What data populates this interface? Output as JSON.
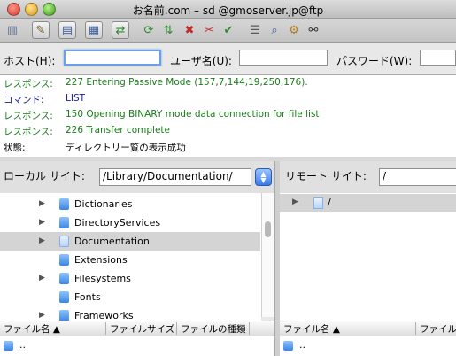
{
  "window": {
    "title": "お名前.com – sd                @gmoserver.jp@ftp"
  },
  "toolbar": {
    "icons": [
      "site-manager-icon",
      "toggle-log-icon",
      "toggle-local-tree-icon",
      "toggle-remote-tree-icon",
      "toggle-queue-icon",
      "refresh-icon",
      "process-queue-icon",
      "cancel-icon",
      "disconnect-icon",
      "reconnect-icon",
      "filter-icon",
      "compare-icon",
      "sync-browse-icon",
      "search-icon"
    ]
  },
  "quickconnect": {
    "host_label": "ホスト(H):",
    "host_value": "",
    "user_label": "ユーザ名(U):",
    "user_value": "",
    "pass_label": "パスワード(W):",
    "pass_value": ""
  },
  "log": [
    {
      "label": "レスポンス:",
      "message": "227 Entering Passive Mode (157,7,144,19,250,176).",
      "color": "#1a7a1a"
    },
    {
      "label": "コマンド:",
      "message": "LIST",
      "color": "#1a1a9a"
    },
    {
      "label": "レスポンス:",
      "message": "150 Opening BINARY mode data connection for file list",
      "color": "#1a7a1a"
    },
    {
      "label": "レスポンス:",
      "message": "226 Transfer complete",
      "color": "#1a7a1a"
    },
    {
      "label": "状態:",
      "message": "ディレクトリー覧の表示成功",
      "color": "#000000"
    }
  ],
  "local": {
    "label": "ローカル サイト:",
    "path": "/Library/Documentation/",
    "tree": [
      {
        "name": "Dictionaries",
        "expandable": true,
        "selected": false,
        "icon": "folder"
      },
      {
        "name": "DirectoryServices",
        "expandable": true,
        "selected": false,
        "icon": "folder"
      },
      {
        "name": "Documentation",
        "expandable": true,
        "selected": true,
        "icon": "document-folder"
      },
      {
        "name": "Extensions",
        "expandable": false,
        "selected": false,
        "icon": "folder"
      },
      {
        "name": "Filesystems",
        "expandable": true,
        "selected": false,
        "icon": "folder"
      },
      {
        "name": "Fonts",
        "expandable": false,
        "selected": false,
        "icon": "folder"
      },
      {
        "name": "Frameworks",
        "expandable": true,
        "selected": false,
        "icon": "folder"
      }
    ],
    "columns": [
      "ファイル名 ▲",
      "ファイルサイズ",
      "ファイルの種類"
    ],
    "entries": [
      ".."
    ]
  },
  "remote": {
    "label": "リモート サイト:",
    "path": "/",
    "tree": [
      {
        "name": "/",
        "expandable": true,
        "selected": true,
        "icon": "document-folder"
      }
    ],
    "columns": [
      "ファイル名 ▲",
      "ファイル"
    ],
    "entries": [
      ".."
    ]
  }
}
